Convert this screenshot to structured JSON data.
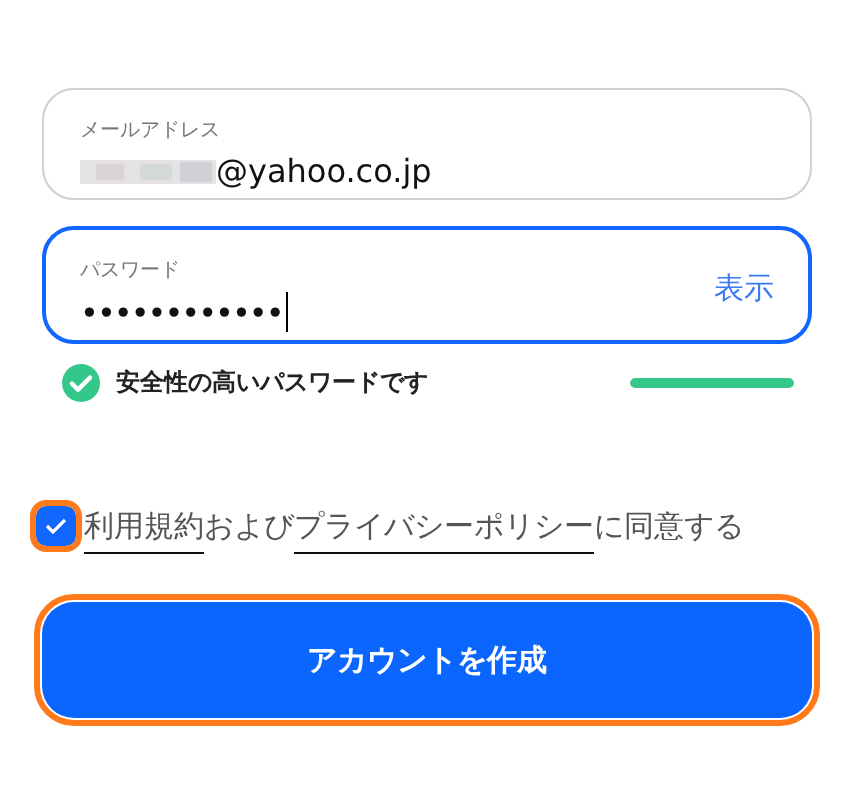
{
  "email": {
    "label": "メールアドレス",
    "value": "@yahoo.co.jp",
    "redacted": true,
    "focused": false
  },
  "password": {
    "label": "パスワード",
    "value": "••••••••••••",
    "focused": true,
    "toggle": "表示"
  },
  "strength": {
    "message": "安全性の高いパスワードです",
    "level": 1
  },
  "agreement": {
    "checked": true,
    "highlighted": true,
    "parts": [
      {
        "kind": "link",
        "text": "利用規約"
      },
      {
        "kind": "text",
        "text": "および"
      },
      {
        "kind": "link",
        "text": "プライバシーポリシー"
      },
      {
        "kind": "text",
        "text": "に同意する"
      }
    ]
  },
  "submit": {
    "label": "アカウントを作成",
    "highlighted": true
  }
}
